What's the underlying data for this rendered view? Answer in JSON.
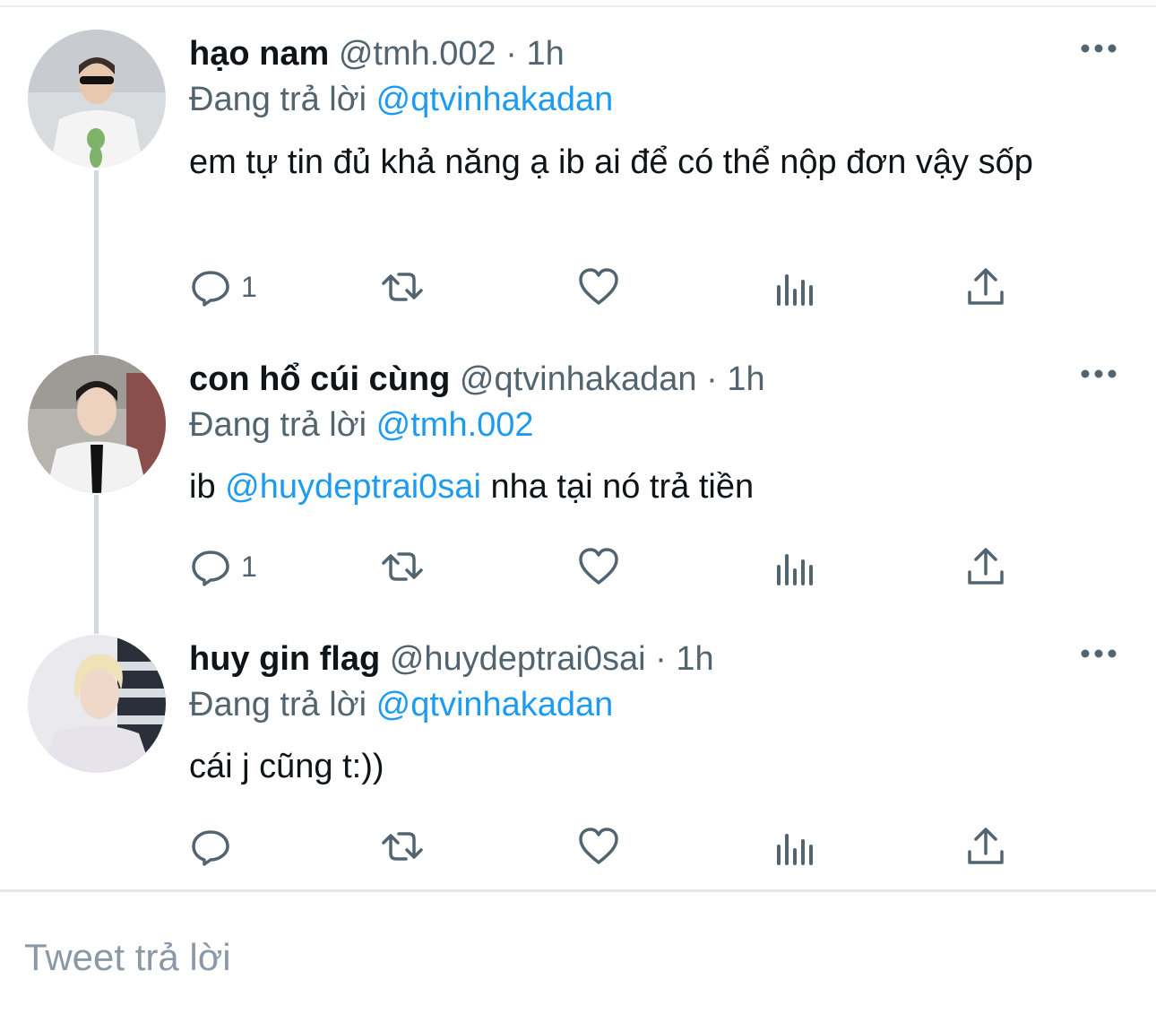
{
  "reply_prefix": "Đang trả lời",
  "tweets": [
    {
      "name": "hạo nam",
      "handle": "@tmh.002",
      "separator": "·",
      "time": "1h",
      "reply_to": "@qtvinhakadan",
      "text_parts": [
        {
          "text": "em tự tin đủ khả năng ạ ib ai để có thể nộp đơn vậy sốp",
          "mention": false
        }
      ],
      "reply_count": "1"
    },
    {
      "name": "con hổ cúi cùng",
      "handle": "@qtvinhakadan",
      "separator": "·",
      "time": "1h",
      "reply_to": "@tmh.002",
      "text_parts": [
        {
          "text": "ib ",
          "mention": false
        },
        {
          "text": "@huydeptrai0sai",
          "mention": true
        },
        {
          "text": " nha tại nó trả tiền",
          "mention": false
        }
      ],
      "reply_count": "1"
    },
    {
      "name": "huy gin flag",
      "handle": "@huydeptrai0sai",
      "separator": "·",
      "time": "1h",
      "reply_to": "@qtvinhakadan",
      "text_parts": [
        {
          "text": "cái j cũng t:))",
          "mention": false
        }
      ],
      "reply_count": ""
    }
  ],
  "compose_placeholder": "Tweet trả lời",
  "icons": {
    "reply": "reply-icon",
    "retweet": "retweet-icon",
    "like": "heart-icon",
    "views": "analytics-icon",
    "share": "share-icon",
    "more": "more-icon"
  },
  "colors": {
    "mention": "#1d9bf0",
    "secondary": "#536471",
    "text": "#0f1419"
  }
}
